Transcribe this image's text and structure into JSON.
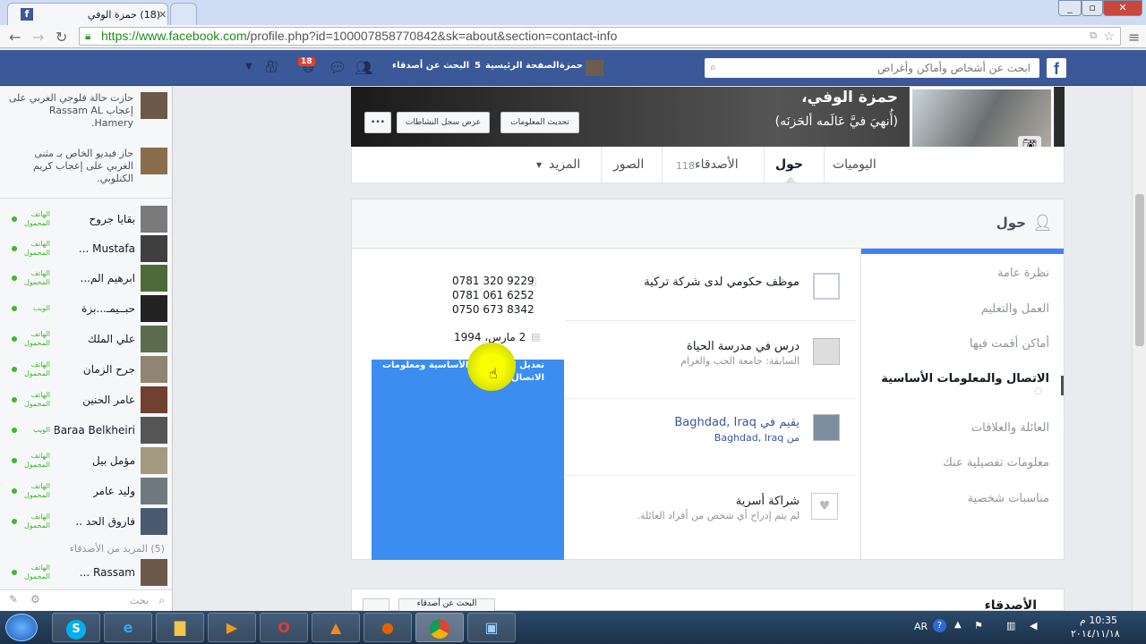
{
  "browser": {
    "tab_title": "(18) حمزة الوفي",
    "url": "https://www.facebook.com/profile.php?id=100007858770842&sk=about&section=contact-info",
    "url_host": "https://www.facebook.com",
    "url_path": "/profile.php?id=100007858770842&sk=about&section=contact-info"
  },
  "fbheader": {
    "search_placeholder": "ابحث عن أشخاص وأماكن وأغراض",
    "profile_name": "حمزة",
    "home": "الصفحة الرئيسية",
    "home_count": "5",
    "find_friends": "البحث عن أصدقاء",
    "notif_badge": "18"
  },
  "sidebar": {
    "stories": [
      {
        "text": "حازت حالة فلوجي الغربي على إعجاب Rassam AL Hamery."
      },
      {
        "text": "حاز فيديو الخاص بـ مثنى الغربي على إعجاب كريم الكنلوبي."
      }
    ],
    "friends": [
      {
        "name": "بقايا جروح",
        "status": "الهاتف المحمول"
      },
      {
        "name": "Mustafa ...",
        "status": "الهاتف المحمول"
      },
      {
        "name": "ابرهيم الم...",
        "status": "الهاتف المحمول"
      },
      {
        "name": "حبــيمـ...بزة",
        "status": "الويب"
      },
      {
        "name": "علي الملك",
        "status": "الهاتف المحمول"
      },
      {
        "name": "جرح الزمان",
        "status": "الهاتف المحمول"
      },
      {
        "name": "عامر الحنين",
        "status": "الهاتف المحمول"
      },
      {
        "name": "Baraa Belkheiri",
        "status": "الويب"
      },
      {
        "name": "مؤمل بيل",
        "status": "الهاتف المحمول"
      },
      {
        "name": "وليد عامر",
        "status": "الهاتف المحمول"
      },
      {
        "name": "فاروق الحد ..",
        "status": "الهاتف المحمول"
      }
    ],
    "more_friends": "(5) المزيد من الأصدقاء",
    "last_friend": {
      "name": "Rassam ...",
      "status": "الهاتف المحمول"
    },
    "search_label": "بحث"
  },
  "profile": {
    "name": "حمزة الوفي،",
    "tagline": "(أُنهيَ فيَّ عَالَمه ألحَزنَه)",
    "update_info": "تحديث المعلومات",
    "activity_log": "عرض سجل النشاطات",
    "more_dots": "•••",
    "tabs": {
      "timeline": "اليوميات",
      "about": "حول",
      "friends": "الأصدقاء",
      "friends_count": "118",
      "photos": "الصور",
      "more": "المزيد"
    }
  },
  "about": {
    "title": "حول",
    "nav": [
      "نظرة عامة",
      "العمل والتعليم",
      "أماكن أقمت فيها",
      "الاتصال والمعلومات الأساسية",
      "العائلة والعلاقات",
      "معلومات تفصيلية عنك",
      "مناسبات شخصية"
    ],
    "work": "موظف حكومي لدى شركة تركية",
    "phones": [
      "0781 320 9229",
      "0781 061 6252",
      "0750 673 8342"
    ],
    "birthday": "2 مارس، 1994",
    "edit_link": "تعديل المعلومات الأساسية ومعلومات الاتصال",
    "study": "درس في مدرسة الحياة",
    "study_sub": "السابقة: جامعة الحب والغرام",
    "lives": "يقيم في Baghdad, Iraq",
    "from": "من Baghdad, Iraq",
    "partner_title": "شراكة أسرية",
    "partner_sub": "لم يتم إدراج أي شخص من أفراد العائلة."
  },
  "bottom": {
    "friends_title": "الأصدقاء",
    "find_friends_btn": "البحث عن أصدقاء"
  },
  "taskbar": {
    "lang": "AR",
    "time": "10:35 م",
    "date": "٢٠١٤/١١/١٨"
  }
}
